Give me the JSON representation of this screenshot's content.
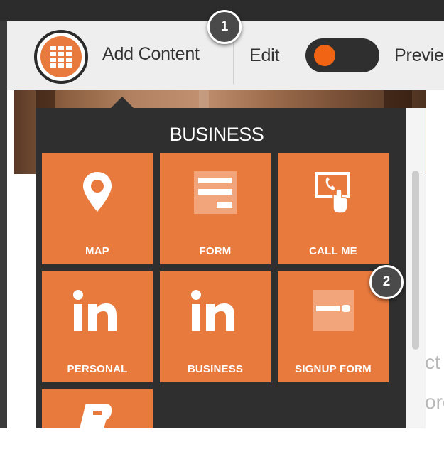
{
  "toolbar": {
    "add_content_label": "Add Content",
    "edit_label": "Edit",
    "preview_label": "Previe",
    "toggle_state": "edit-on",
    "accent_color": "#f06414"
  },
  "panel": {
    "title": "BUSINESS",
    "tiles": [
      {
        "label": "MAP",
        "icon": "map-pin-icon"
      },
      {
        "label": "FORM",
        "icon": "form-icon"
      },
      {
        "label": "CALL ME",
        "icon": "call-me-icon"
      },
      {
        "label": "PERSONAL",
        "icon": "linkedin-icon"
      },
      {
        "label": "BUSINESS",
        "icon": "linkedin-icon"
      },
      {
        "label": "SIGNUP FORM",
        "icon": "signup-form-icon"
      },
      {
        "label": "",
        "icon": "blogger-icon"
      }
    ],
    "tile_color": "#e87a3e"
  },
  "badges": [
    "1",
    "2"
  ],
  "background_text": [
    "ct",
    "ore"
  ]
}
